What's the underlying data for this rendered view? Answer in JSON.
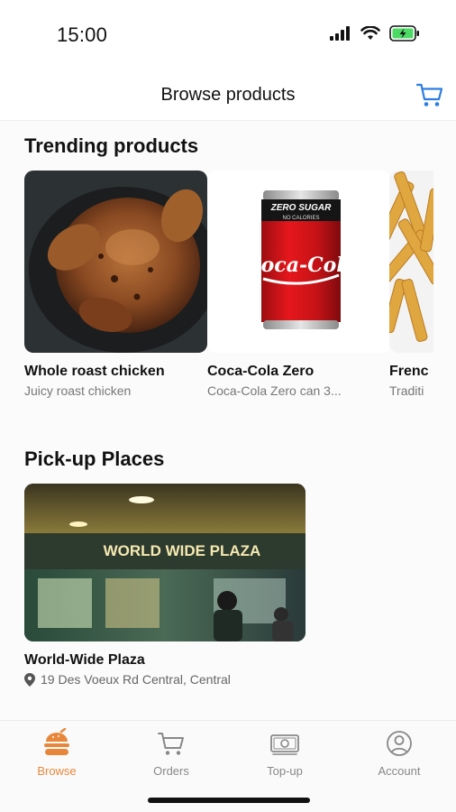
{
  "status_bar": {
    "time": "15:00"
  },
  "nav": {
    "title": "Browse products"
  },
  "trending": {
    "title": "Trending products",
    "products": [
      {
        "name": "Whole roast chicken",
        "description": "Juicy roast chicken"
      },
      {
        "name": "Coca-Cola Zero",
        "description": "Coca-Cola Zero can 3..."
      },
      {
        "name": "Frenc",
        "description": "Traditi"
      }
    ]
  },
  "pickup": {
    "title": "Pick-up Places",
    "places": [
      {
        "name": "World-Wide Plaza",
        "address": "19 Des Voeux Rd Central, Central",
        "sign_text": "WORLD WIDE PLAZA"
      }
    ]
  },
  "can": {
    "top_text": "ZERO SUGAR",
    "sub_text": "NO CALORIES",
    "brand_text": "Coca-Cola"
  },
  "tabs": [
    {
      "label": "Browse",
      "icon": "burger-icon",
      "active": true
    },
    {
      "label": "Orders",
      "icon": "cart-icon",
      "active": false
    },
    {
      "label": "Top-up",
      "icon": "money-icon",
      "active": false
    },
    {
      "label": "Account",
      "icon": "account-icon",
      "active": false
    }
  ],
  "colors": {
    "accent": "#e8873a",
    "cart_blue": "#2f7de1",
    "inactive": "#888888"
  }
}
